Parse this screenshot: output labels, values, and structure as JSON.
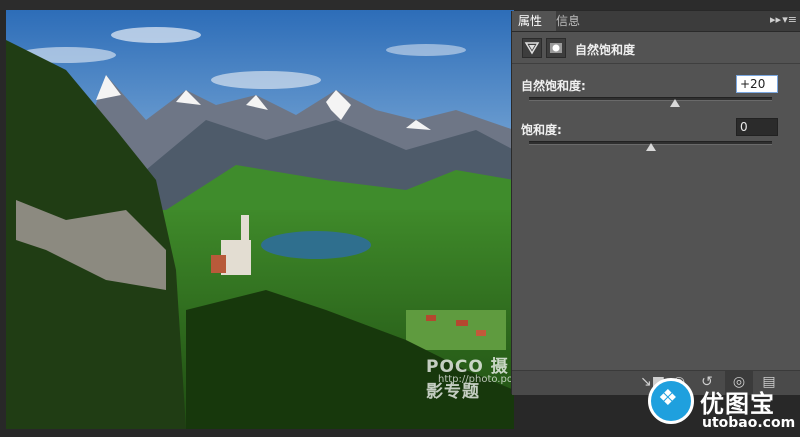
{
  "panel": {
    "tabs": [
      {
        "label": "属性"
      },
      {
        "label": "信息"
      }
    ],
    "collapse_icon": "double-chevron-right-icon",
    "menu_icon": "panel-menu-icon",
    "header": {
      "adjustment_icon": "triangle-adjustment-icon",
      "mask_icon": "layer-mask-icon",
      "title": "自然饱和度"
    },
    "vibrance": {
      "label": "自然饱和度:",
      "value": "+20",
      "level": 0.6
    },
    "saturation": {
      "label": "饱和度:",
      "value": "0",
      "level": 0.5
    },
    "footer_icons": [
      "clip-to-layer-icon",
      "view-previous-icon",
      "reset-icon",
      "visibility-eye-icon",
      "trash-icon"
    ]
  },
  "photo": {
    "description_icon": "landscape-photo",
    "watermark": "POCO 摄影专题",
    "watermark_url": "http://photo.poco.cn/"
  },
  "brand": {
    "logo_icon": "bird-logo-icon",
    "name": "优图宝",
    "url": "utobao.com",
    "color": "#1fa0de"
  }
}
